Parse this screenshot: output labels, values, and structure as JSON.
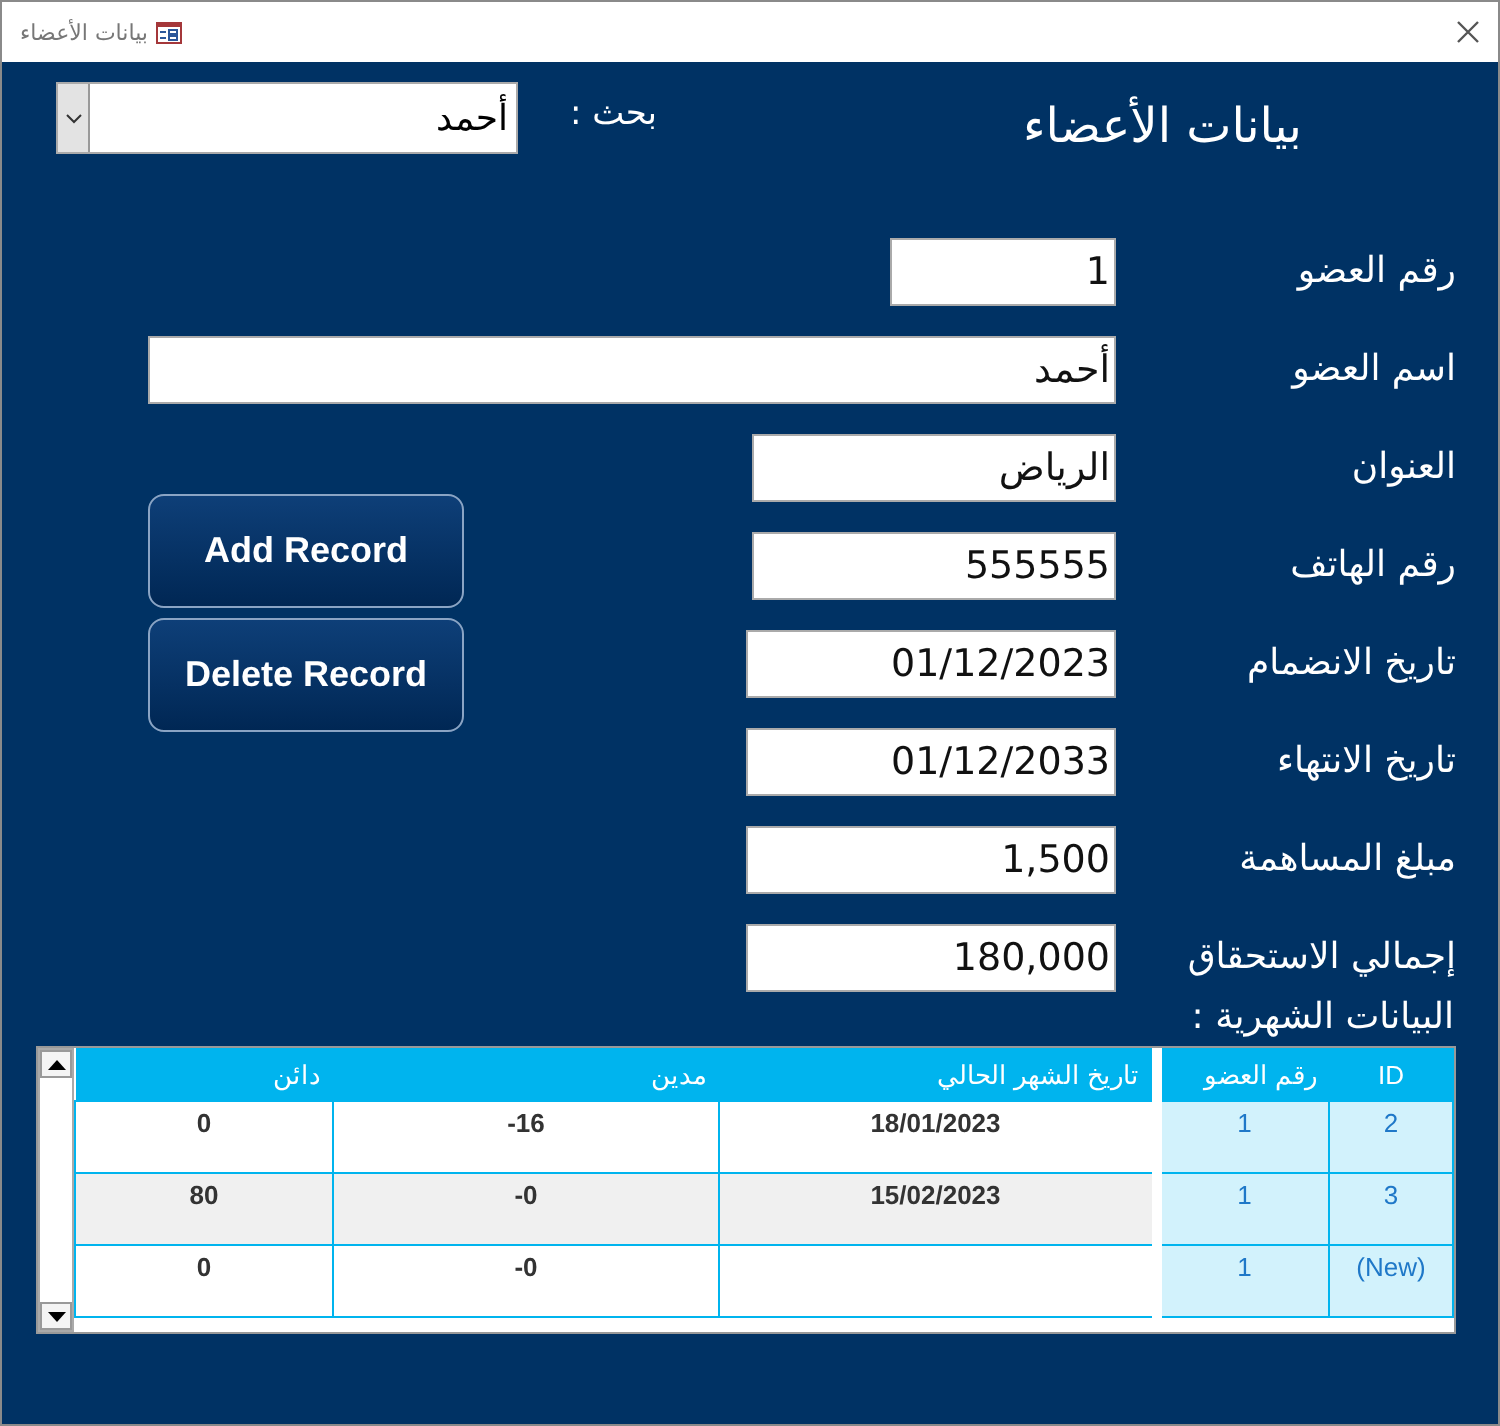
{
  "window": {
    "title": "بيانات الأعضاء"
  },
  "header": {
    "title": "بيانات الأعضاء",
    "search_label": "بحث :",
    "search_value": "أحمد"
  },
  "fields": [
    {
      "label": "رقم العضو",
      "value": "1"
    },
    {
      "label": "اسم العضو",
      "value": "أحمد"
    },
    {
      "label": "العنوان",
      "value": "الرياض"
    },
    {
      "label": "رقم الهاتف",
      "value": "555555"
    },
    {
      "label": "تاريخ الانضمام",
      "value": "01/12/2023"
    },
    {
      "label": "تاريخ الانتهاء",
      "value": "01/12/2033"
    },
    {
      "label": "مبلغ المساهمة",
      "value": "1,500"
    },
    {
      "label": "إجمالي الاستحقاق",
      "value": "180,000"
    }
  ],
  "buttons": [
    "Add Record",
    "Delete Record"
  ],
  "monthly": {
    "title": "البيانات الشهرية :",
    "columns": [
      "ID",
      "رقم العضو",
      "تاريخ الشهر الحالي",
      "مدين",
      "دائن"
    ],
    "rows": [
      {
        "id": "2",
        "member": "1",
        "date": "18/01/2023",
        "debit": "-16",
        "credit": "0"
      },
      {
        "id": "3",
        "member": "1",
        "date": "15/02/2023",
        "debit": "-0",
        "credit": "80"
      },
      {
        "id": "(New)",
        "member": "1",
        "debit": "-0",
        "credit": "0"
      }
    ]
  }
}
